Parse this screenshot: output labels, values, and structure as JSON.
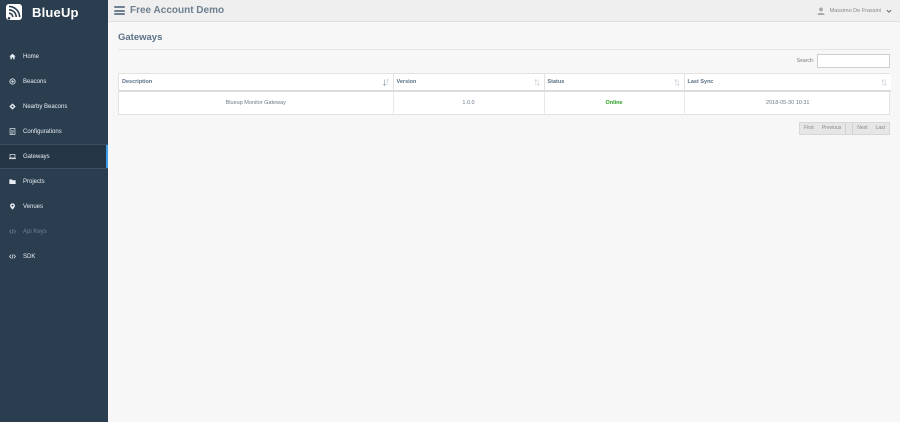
{
  "brand": {
    "name": "BlueUp",
    "icon": "wifi-logo-icon"
  },
  "header": {
    "title": "Free Account Demo",
    "user_name": "Massimo De Frassini"
  },
  "sidebar": {
    "items": [
      {
        "label": "Home",
        "icon": "home-icon"
      },
      {
        "label": "Beacons",
        "icon": "beacon-icon"
      },
      {
        "label": "Nearby Beacons",
        "icon": "nearby-icon"
      },
      {
        "label": "Configurations",
        "icon": "configurations-icon"
      },
      {
        "label": "Gateways",
        "icon": "laptop-icon",
        "active": true
      },
      {
        "label": "Projects",
        "icon": "folder-icon"
      },
      {
        "label": "Venues",
        "icon": "map-marker-icon"
      },
      {
        "label": "Api Keys",
        "icon": "code-icon",
        "disabled": true
      },
      {
        "label": "SDK",
        "icon": "code-icon"
      }
    ]
  },
  "main": {
    "page_title": "Gateways",
    "search_label": "Search:",
    "search_value": "",
    "table": {
      "columns": [
        "Description",
        "Version",
        "Status",
        "Last Sync"
      ],
      "rows": [
        {
          "description": "Blueup Monitor Gateway",
          "version": "1.0.0",
          "status": "Online",
          "last_sync": "2018-05-30 10:31"
        }
      ]
    },
    "pagination": {
      "first": "First",
      "previous": "Previous",
      "next": "Next",
      "last": "Last"
    }
  },
  "colors": {
    "sidebar_bg": "#2b3e50",
    "active_accent": "#3d9be9",
    "status_online": "#2aa01f",
    "title": "#5b7186"
  }
}
